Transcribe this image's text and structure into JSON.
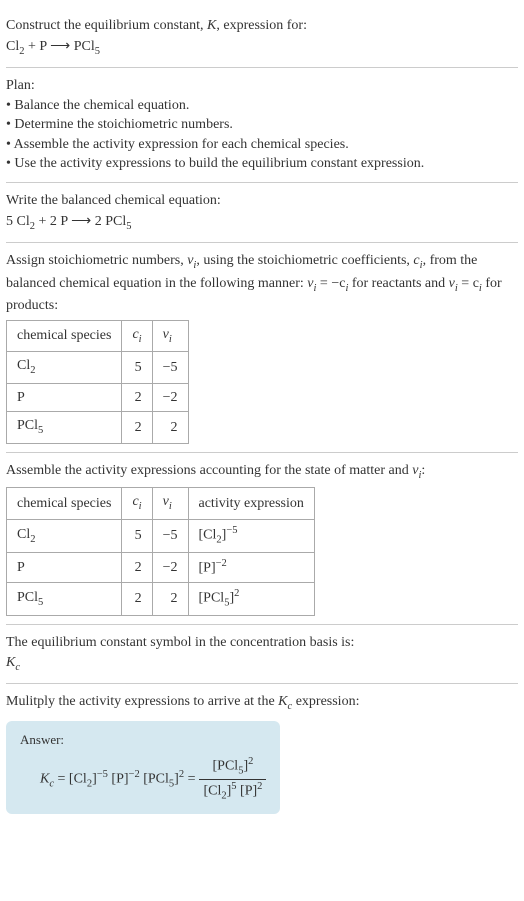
{
  "header": {
    "line1": "Construct the equilibrium constant, ",
    "k": "K",
    "line1b": ", expression for:",
    "eq_cl2": "Cl",
    "eq_plus": " + P ",
    "eq_arrow": "⟶",
    "eq_pcl5": " PCl"
  },
  "plan": {
    "title": "Plan:",
    "item1": "• Balance the chemical equation.",
    "item2": "• Determine the stoichiometric numbers.",
    "item3": "• Assemble the activity expression for each chemical species.",
    "item4": "• Use the activity expressions to build the equilibrium constant expression."
  },
  "balanced": {
    "title": "Write the balanced chemical equation:",
    "c1": "5 Cl",
    "c2": " + 2 P ",
    "arrow": "⟶",
    "c3": " 2 PCl"
  },
  "stoich": {
    "intro1": "Assign stoichiometric numbers, ",
    "nu": "ν",
    "i": "i",
    "intro2": ", using the stoichiometric coefficients, ",
    "c": "c",
    "intro3": ", from the balanced chemical equation in the following manner: ",
    "eq1a": "ν",
    "eq1b": " = −c",
    "intro4": " for reactants and ",
    "eq2a": "ν",
    "eq2b": " = c",
    "intro5": " for products:",
    "h1": "chemical species",
    "h2": "c",
    "h3": "ν",
    "r1c1": "Cl",
    "r1c2": "5",
    "r1c3": "−5",
    "r2c1": "P",
    "r2c2": "2",
    "r2c3": "−2",
    "r3c1": "PCl",
    "r3c2": "2",
    "r3c3": "2"
  },
  "activity": {
    "intro1": "Assemble the activity expressions accounting for the state of matter and ",
    "nu": "ν",
    "i": "i",
    "intro2": ":",
    "h1": "chemical species",
    "h2": "c",
    "h3": "ν",
    "h4": "activity expression",
    "r1c1": "Cl",
    "r1c2": "5",
    "r1c3": "−5",
    "r1c4a": "[Cl",
    "r1c4b": "]",
    "r1c4exp": "−5",
    "r2c1": "P",
    "r2c2": "2",
    "r2c3": "−2",
    "r2c4a": "[P]",
    "r2c4exp": "−2",
    "r3c1": "PCl",
    "r3c2": "2",
    "r3c3": "2",
    "r3c4a": "[PCl",
    "r3c4b": "]",
    "r3c4exp": "2"
  },
  "symbol": {
    "line1": "The equilibrium constant symbol in the concentration basis is:",
    "kc": "K",
    "c": "c"
  },
  "multiply": {
    "line1": "Mulitply the activity expressions to arrive at the ",
    "kc": "K",
    "c": "c",
    "line2": " expression:"
  },
  "answer": {
    "label": "Answer:",
    "kc": "K",
    "c": "c",
    "eq": " = [Cl",
    "two": "2",
    "rb": "]",
    "m5": "−5",
    "p": " [P]",
    "m2": "−2",
    "pcl": " [PCl",
    "five": "5",
    "sq": "2",
    "equals": " = ",
    "num_a": "[PCl",
    "num_b": "]",
    "den_a": "[Cl",
    "den_b": "]",
    "den_p": " [P]"
  }
}
